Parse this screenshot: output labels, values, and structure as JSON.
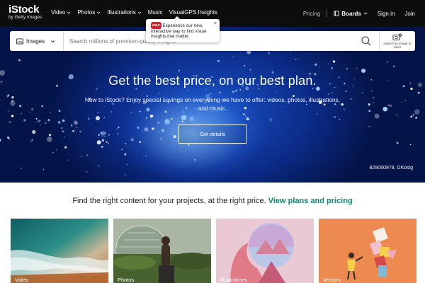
{
  "header": {
    "logo": "iStock",
    "logo_sub": "by Getty Images",
    "nav": [
      {
        "label": "Video",
        "has_dropdown": true
      },
      {
        "label": "Photos",
        "has_dropdown": true
      },
      {
        "label": "Illustrations",
        "has_dropdown": true
      },
      {
        "label": "Music",
        "has_dropdown": false
      },
      {
        "label": "VisualGPS Insights",
        "has_dropdown": false
      }
    ],
    "pricing": "Pricing",
    "boards": "Boards",
    "signin": "Sign in",
    "join": "Join"
  },
  "tooltip": {
    "badge": "NEW",
    "text": "Experience our new, interactive way to find visual insights that matter.",
    "close_icon": "×"
  },
  "search": {
    "media_type": "Images",
    "placeholder": "Search millions of premium-quality images",
    "image_search_label": "Search by image or video"
  },
  "hero": {
    "title": "Get the best price, on our best plan.",
    "subtitle": "New to iStock? Enjoy special savings on everything we have to offer: videos, photos, illustrations, and music.",
    "cta": "Get details",
    "credit": "829060978, DKosig"
  },
  "promo": {
    "text": "Find the right content for your projects, at the right price.",
    "link": "View plans and pricing"
  },
  "cards": [
    {
      "label": "Video"
    },
    {
      "label": "Photos"
    },
    {
      "label": "Illustrations"
    },
    {
      "label": "Vectors"
    }
  ],
  "colors": {
    "header_bg": "#0c0d0d",
    "link_green": "#0c8b6e",
    "hero_blue": "#0b2a86",
    "new_badge": "#e11d2e"
  }
}
